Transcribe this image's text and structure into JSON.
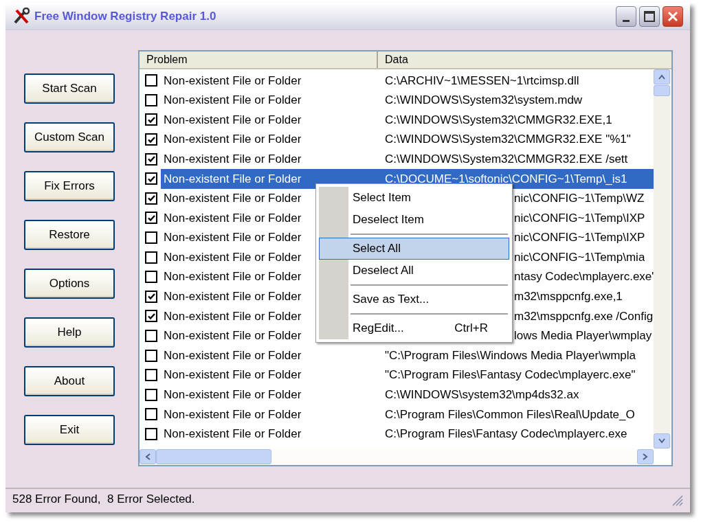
{
  "window": {
    "title": "Free Window Registry Repair 1.0"
  },
  "buttons": [
    "Start Scan",
    "Custom Scan",
    "Fix Errors",
    "Restore",
    "Options",
    "Help",
    "About",
    "Exit"
  ],
  "table": {
    "columns": [
      "Problem",
      "Data"
    ],
    "rows": [
      {
        "problem": "Non-existent File or Folder",
        "data": "C:\\ARCHIV~1\\MESSEN~1\\rtcimsp.dll",
        "checked": false,
        "selected": false,
        "partly_hidden": false
      },
      {
        "problem": "Non-existent File or Folder",
        "data": "C:\\WINDOWS\\System32\\system.mdw",
        "checked": false,
        "selected": false,
        "partly_hidden": false
      },
      {
        "problem": "Non-existent File or Folder",
        "data": "C:\\WINDOWS\\System32\\CMMGR32.EXE,1",
        "checked": true,
        "selected": false,
        "partly_hidden": false
      },
      {
        "problem": "Non-existent File or Folder",
        "data": "C:\\WINDOWS\\System32\\CMMGR32.EXE \"%1\"",
        "checked": true,
        "selected": false,
        "partly_hidden": false
      },
      {
        "problem": "Non-existent File or Folder",
        "data": "C:\\WINDOWS\\System32\\CMMGR32.EXE /sett",
        "checked": true,
        "selected": false,
        "partly_hidden": false
      },
      {
        "problem": "Non-existent File or Folder",
        "data": "C:\\DOCUME~1\\softonic\\CONFIG~1\\Temp\\_is1",
        "checked": true,
        "selected": true,
        "partly_hidden": false
      },
      {
        "problem": "Non-existent File or Folder",
        "data": "nic\\CONFIG~1\\Temp\\WZ",
        "checked": true,
        "selected": false,
        "partly_hidden": true
      },
      {
        "problem": "Non-existent File or Folder",
        "data": "nic\\CONFIG~1\\Temp\\IXP",
        "checked": true,
        "selected": false,
        "partly_hidden": true
      },
      {
        "problem": "Non-existent File or Folder",
        "data": "nic\\CONFIG~1\\Temp\\IXP",
        "checked": false,
        "selected": false,
        "partly_hidden": true
      },
      {
        "problem": "Non-existent File or Folder",
        "data": "nic\\CONFIG~1\\Temp\\mia",
        "checked": false,
        "selected": false,
        "partly_hidden": true
      },
      {
        "problem": "Non-existent File or Folder",
        "data": "ntasy Codec\\mplayerc.exe\"",
        "checked": false,
        "selected": false,
        "partly_hidden": true
      },
      {
        "problem": "Non-existent File or Folder",
        "data": "m32\\msppcnfg.exe,1",
        "checked": true,
        "selected": false,
        "partly_hidden": true
      },
      {
        "problem": "Non-existent File or Folder",
        "data": "m32\\msppcnfg.exe /Config",
        "checked": true,
        "selected": false,
        "partly_hidden": true
      },
      {
        "problem": "Non-existent File or Folder",
        "data": "lows Media Player\\wmplay",
        "checked": false,
        "selected": false,
        "partly_hidden": true
      },
      {
        "problem": "Non-existent File or Folder",
        "data": "\"C:\\Program Files\\Windows Media Player\\wmpla",
        "checked": false,
        "selected": false,
        "partly_hidden": false
      },
      {
        "problem": "Non-existent File or Folder",
        "data": "\"C:\\Program Files\\Fantasy Codec\\mplayerc.exe\"",
        "checked": false,
        "selected": false,
        "partly_hidden": false
      },
      {
        "problem": "Non-existent File or Folder",
        "data": "C:\\WINDOWS\\system32\\mp4ds32.ax",
        "checked": false,
        "selected": false,
        "partly_hidden": false
      },
      {
        "problem": "Non-existent File or Folder",
        "data": "C:\\Program Files\\Common Files\\Real\\Update_O",
        "checked": false,
        "selected": false,
        "partly_hidden": false
      },
      {
        "problem": "Non-existent File or Folder",
        "data": "C:\\Program Files\\Fantasy Codec\\mplayerc.exe",
        "checked": false,
        "selected": false,
        "partly_hidden": false
      }
    ]
  },
  "context_menu": {
    "items": [
      {
        "kind": "item",
        "label": "Select Item",
        "selected": false
      },
      {
        "kind": "item",
        "label": "Deselect Item",
        "selected": false
      },
      {
        "kind": "separator"
      },
      {
        "kind": "item",
        "label": "Select All",
        "selected": true
      },
      {
        "kind": "item",
        "label": "Deselect All",
        "selected": false
      },
      {
        "kind": "separator"
      },
      {
        "kind": "item",
        "label": "Save as Text...",
        "selected": false
      },
      {
        "kind": "separator"
      },
      {
        "kind": "item",
        "label": "RegEdit...",
        "shortcut": "Ctrl+R",
        "selected": false
      }
    ]
  },
  "status_bar": "528 Error Found,  8 Error Selected."
}
